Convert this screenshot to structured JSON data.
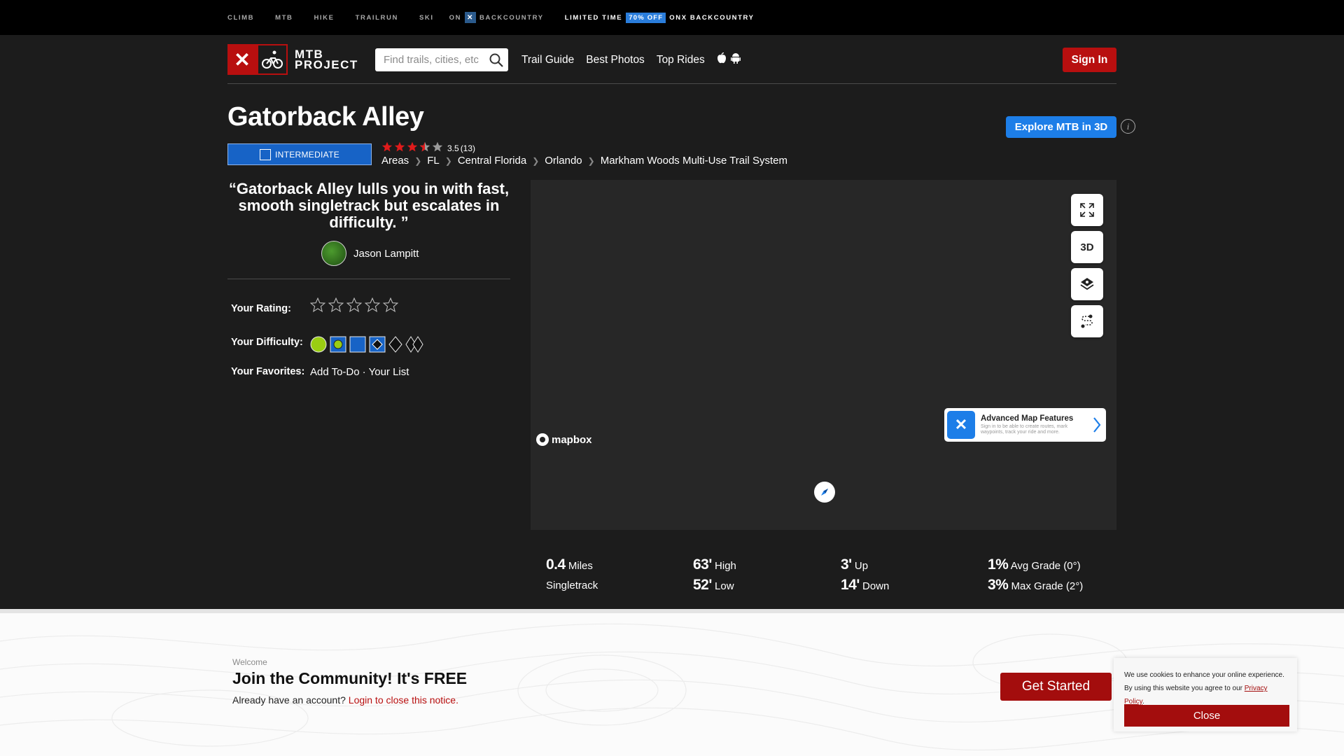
{
  "topbar": {
    "links": [
      "CLIMB",
      "MTB",
      "HIKE",
      "TRAILRUN",
      "SKI"
    ],
    "on_label": "ON",
    "backcountry_label": "BACKCOUNTRY",
    "promo_prefix": "LIMITED TIME",
    "promo_pct": "70% OFF",
    "promo_suffix": "ONX BACKCOUNTRY"
  },
  "header": {
    "brand_line1": "MTB",
    "brand_line2": "PROJECT",
    "search_placeholder": "Find trails, cities, etc",
    "nav": [
      "Trail Guide",
      "Best Photos",
      "Top Rides"
    ],
    "sign_in": "Sign In"
  },
  "trail": {
    "title": "Gatorback Alley",
    "difficulty": "INTERMEDIATE",
    "rating": "3.5",
    "rating_count": "(13)",
    "stars_filled": 3.5,
    "breadcrumbs": [
      "Areas",
      "FL",
      "Central Florida",
      "Orlando",
      "Markham Woods Multi-Use Trail System"
    ],
    "explore_3d": "Explore MTB in 3D",
    "quote": "“Gatorback Alley lulls you in with fast, smooth singletrack but escalates in difficulty. ”",
    "author": "Jason Lampitt"
  },
  "user": {
    "rating_label": "Your Rating:",
    "difficulty_label": "Your Difficulty:",
    "favorites_label": "Your Favorites:",
    "add_todo": "Add To-Do",
    "separator": "·",
    "your_list": "Your List"
  },
  "map": {
    "btn_3d": "3D",
    "adv_title": "Advanced Map Features",
    "adv_desc": "Sign in to be able to create routes, mark waypoints, track your ride and more.",
    "mapbox": "mapbox"
  },
  "stats": {
    "length_val": "0.4",
    "length_unit": "Miles",
    "trail_type": "Singletrack",
    "high_val": "63'",
    "high_label": "High",
    "low_val": "52'",
    "low_label": "Low",
    "up_val": "3'",
    "up_label": "Up",
    "down_val": "14'",
    "down_label": "Down",
    "avg_val": "1%",
    "avg_label": "Avg Grade (0°)",
    "max_val": "3%",
    "max_label": "Max Grade (2°)"
  },
  "community": {
    "welcome": "Welcome",
    "heading": "Join the Community! It's FREE",
    "already": "Already have an account?",
    "login_link": "Login to close this notice.",
    "cta": "Get Started"
  },
  "cookie": {
    "text": "We use cookies to enhance your online experience. By using this website you agree to our",
    "policy_link": "Privacy Policy",
    "end": ".",
    "close": "Close"
  },
  "colors": {
    "brand_red": "#b80f0f",
    "intermediate_blue": "#1763c6",
    "explore_blue": "#1d7ee8",
    "star_red": "#e01b1b"
  }
}
